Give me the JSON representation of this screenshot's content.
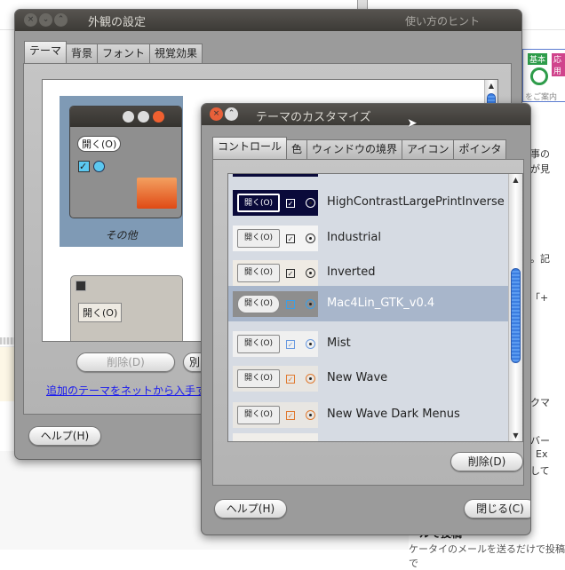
{
  "background": {
    "hint_heading": "使い方のヒント",
    "badges": [
      {
        "label": "基本",
        "color": "#2e9c4a"
      },
      {
        "label": "応用",
        "color": "#d0448c"
      }
    ],
    "badge_caption": "をご案内",
    "fragments": [
      "事の",
      "が見",
      "。記",
      "「+",
      "クマ",
      "バー",
      "Ex",
      "して"
    ],
    "bottom_heading": "ールで投稿",
    "bottom_text": "ケータイのメールを送るだけで投稿で"
  },
  "appearance_window": {
    "title": "外観の設定",
    "tabs": [
      "テーマ",
      "背景",
      "フォント",
      "視覚効果"
    ],
    "active_tab": 0,
    "themes": [
      {
        "name": "その他",
        "preview_button": "開く(O)",
        "selected": true
      },
      {
        "name": "",
        "preview_button": "開く(O)",
        "selected": false
      }
    ],
    "delete_button": "削除(D)",
    "other_button": "別",
    "more_themes_link": "追加のテーマをネットから入手す",
    "help_button": "ヘルプ(H)"
  },
  "customize_window": {
    "title": "テーマのカスタマイズ",
    "tabs": [
      "コントロール",
      "色",
      "ウィンドウの境界",
      "アイコン",
      "ポインタ"
    ],
    "active_tab": 0,
    "preview_button": "開く(O)",
    "themes": [
      {
        "name": "HighContrastLargePrintInverse",
        "bg": "#0a0a3a",
        "fg": "#ffffff",
        "accent": "#ffffff"
      },
      {
        "name": "Industrial",
        "bg": "#f4f4f4",
        "fg": "#222222",
        "accent": "#333333"
      },
      {
        "name": "Inverted",
        "bg": "#efebe4",
        "fg": "#222222",
        "accent": "#333333"
      },
      {
        "name": "Mac4Lin_GTK_v0.4",
        "bg": "#8e8e8e",
        "fg": "#222222",
        "accent": "#3aa0e8",
        "selected": true
      },
      {
        "name": "Mist",
        "bg": "#f0f0f0",
        "fg": "#222222",
        "accent": "#6a9ae0"
      },
      {
        "name": "New Wave",
        "bg": "#e8e6e2",
        "fg": "#222222",
        "accent": "#e07a30"
      },
      {
        "name": "New Wave Dark Menus",
        "bg": "#e8e6e2",
        "fg": "#222222",
        "accent": "#e07a30"
      }
    ],
    "scroll_position": 0.55,
    "delete_button": "削除(D)",
    "help_button": "ヘルプ(H)",
    "close_button": "閉じる(C)"
  }
}
